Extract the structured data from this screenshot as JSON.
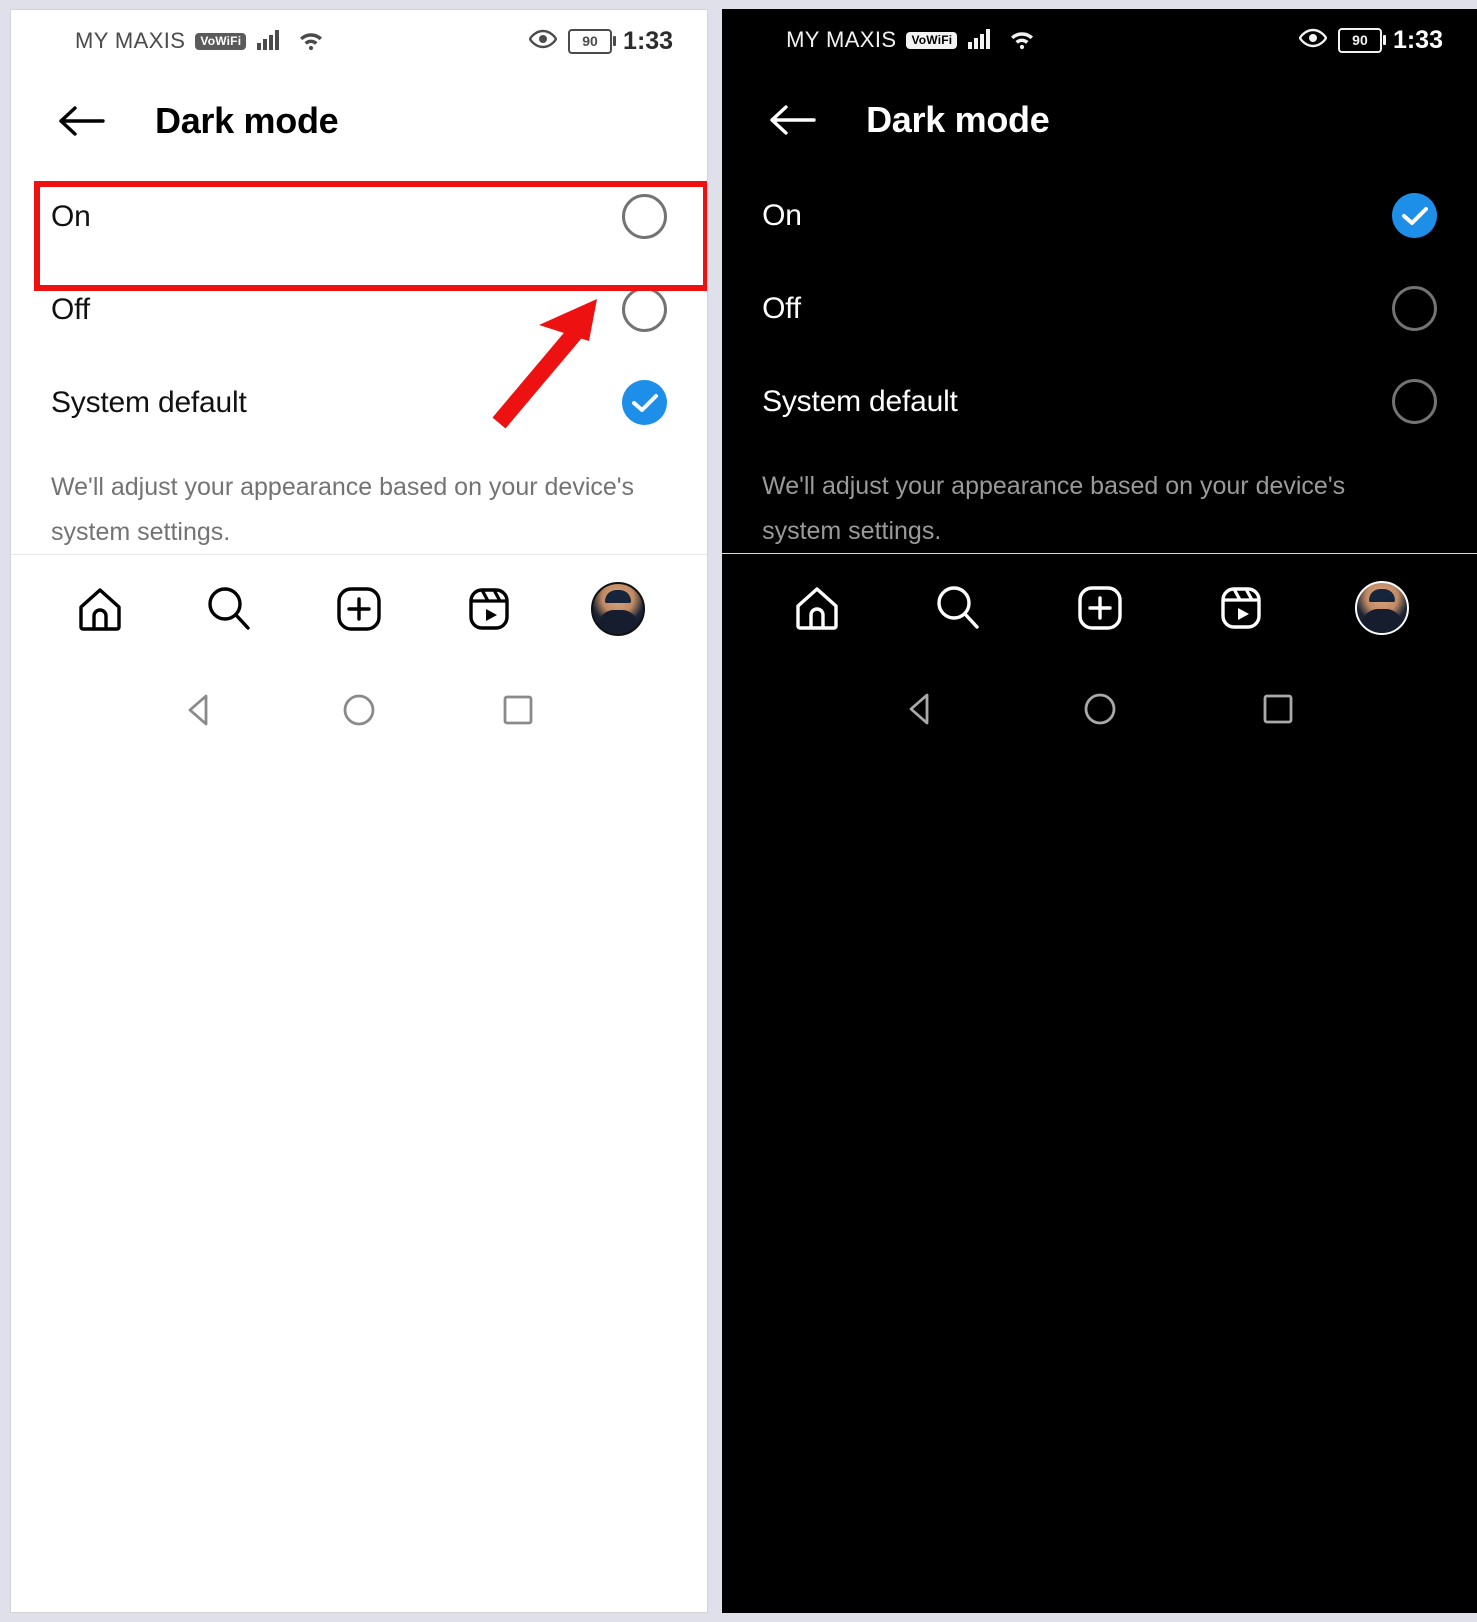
{
  "screens": [
    {
      "theme": "light",
      "status_bar": {
        "carrier": "MY MAXIS",
        "vowifi_badge": "VoWiFi",
        "signal_icon": "cellular-signal-icon",
        "wifi_icon": "wifi-icon",
        "eye_icon": "eye-icon",
        "battery_level": "90",
        "time": "1:33"
      },
      "app_bar": {
        "back_icon": "back-arrow-icon",
        "title": "Dark mode"
      },
      "options": [
        {
          "label": "On",
          "selected": false
        },
        {
          "label": "Off",
          "selected": false
        },
        {
          "label": "System default",
          "selected": true
        }
      ],
      "description": "We'll adjust your appearance based on your device's system settings.",
      "tab_bar": [
        {
          "icon": "home-icon",
          "label": "Home"
        },
        {
          "icon": "search-icon",
          "label": "Search"
        },
        {
          "icon": "add-post-icon",
          "label": "Create"
        },
        {
          "icon": "reels-icon",
          "label": "Reels"
        },
        {
          "icon": "profile-avatar",
          "label": "Profile"
        }
      ],
      "nav_bar": [
        {
          "icon": "android-back-icon",
          "label": "Back"
        },
        {
          "icon": "android-home-icon",
          "label": "Home"
        },
        {
          "icon": "android-recents-icon",
          "label": "Recents"
        }
      ]
    },
    {
      "theme": "dark",
      "status_bar": {
        "carrier": "MY MAXIS",
        "vowifi_badge": "VoWiFi",
        "signal_icon": "cellular-signal-icon",
        "wifi_icon": "wifi-icon",
        "eye_icon": "eye-icon",
        "battery_level": "90",
        "time": "1:33"
      },
      "app_bar": {
        "back_icon": "back-arrow-icon",
        "title": "Dark mode"
      },
      "options": [
        {
          "label": "On",
          "selected": true
        },
        {
          "label": "Off",
          "selected": false
        },
        {
          "label": "System default",
          "selected": false
        }
      ],
      "description": "We'll adjust your appearance based on your device's system settings.",
      "tab_bar": [
        {
          "icon": "home-icon",
          "label": "Home"
        },
        {
          "icon": "search-icon",
          "label": "Search"
        },
        {
          "icon": "add-post-icon",
          "label": "Create"
        },
        {
          "icon": "reels-icon",
          "label": "Reels"
        },
        {
          "icon": "profile-avatar",
          "label": "Profile"
        }
      ],
      "nav_bar": [
        {
          "icon": "android-back-icon",
          "label": "Back"
        },
        {
          "icon": "android-home-icon",
          "label": "Home"
        },
        {
          "icon": "android-recents-icon",
          "label": "Recents"
        }
      ]
    }
  ],
  "annotations": {
    "highlight_box_target": "On",
    "arrow_icon": "pointer-arrow-icon",
    "color": "#ee1111"
  },
  "colors": {
    "accent_blue": "#1e8fe8",
    "radio_outline": "#737373",
    "light_background": "#ffffff",
    "dark_background": "#000000",
    "page_background": "#dfe0ea",
    "muted_text": "#737373"
  }
}
